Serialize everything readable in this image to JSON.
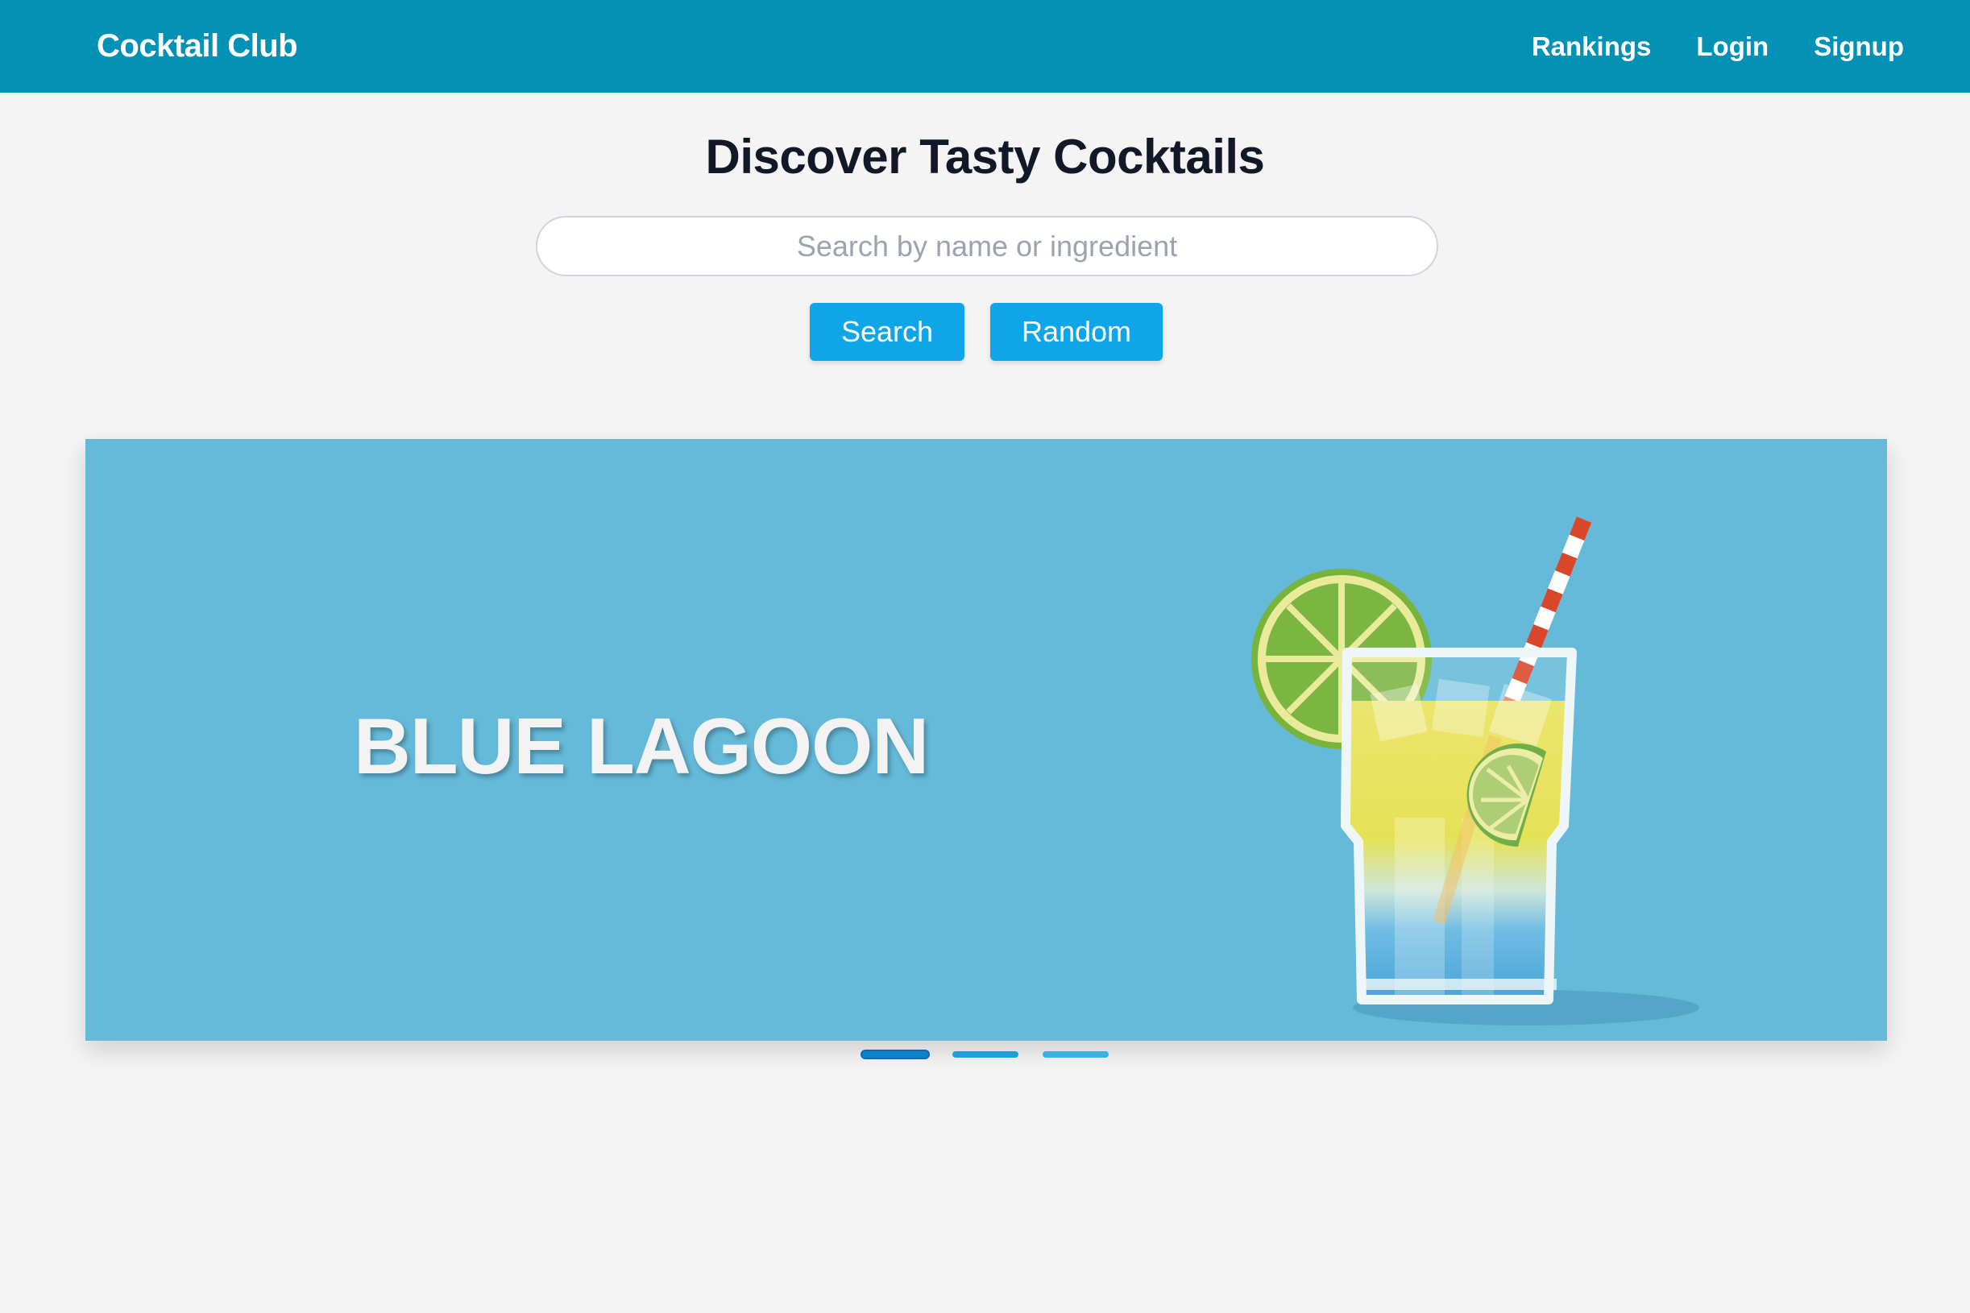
{
  "navbar": {
    "brand": "Cocktail Club",
    "links": [
      {
        "label": "Rankings"
      },
      {
        "label": "Login"
      },
      {
        "label": "Signup"
      }
    ],
    "background_color": "#0391b6"
  },
  "hero": {
    "headline": "Discover Tasty Cocktails",
    "search": {
      "placeholder": "Search by name or ingredient",
      "value": ""
    },
    "buttons": {
      "search_label": "Search",
      "random_label": "Random"
    },
    "button_color": "#0ea5e9"
  },
  "carousel": {
    "background_color": "#65bad9",
    "current_slide": {
      "title": "BLUE LAGOON",
      "image_icon": "cocktail-glass-with-lime-and-straw"
    },
    "slide_count": 3,
    "active_index": 0
  }
}
